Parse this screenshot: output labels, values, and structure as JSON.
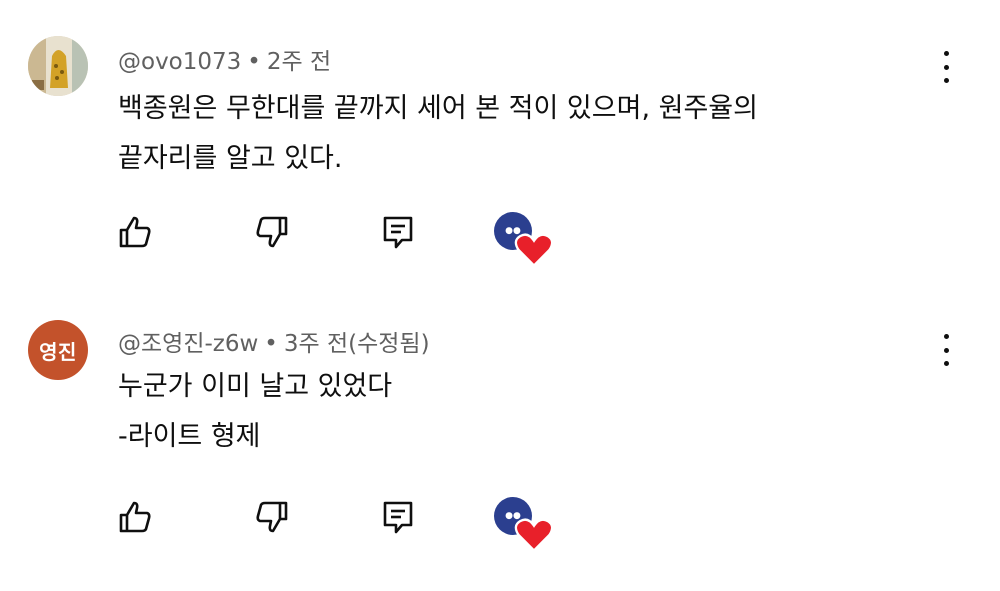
{
  "comments": [
    {
      "handle": "@ovo1073",
      "time": "2주 전",
      "avatar_icon": "user-avatar-photo",
      "lines": [
        "백종원은 무한대를 끝까지 세어 본 적이 있으며, 원주율의",
        "끝자리를 알고 있다."
      ],
      "hearted_by_creator": true
    },
    {
      "handle": "@조영진-z6w",
      "time": "3주 전(수정됨)",
      "avatar_initials": "영진",
      "avatar_color": "#c3522b",
      "lines": [
        "누군가 이미 날고 있었다",
        "-라이트 형제"
      ],
      "hearted_by_creator": true
    }
  ],
  "icons": {
    "like": "thumbs-up-icon",
    "dislike": "thumbs-down-icon",
    "reply": "reply-icon",
    "menu": "more-vertical-icon",
    "creator_heart": "creator-heart-icon"
  },
  "colors": {
    "meta_text": "#606060",
    "heart": "#e8202a",
    "creator_badge": "#2b3f8f"
  }
}
